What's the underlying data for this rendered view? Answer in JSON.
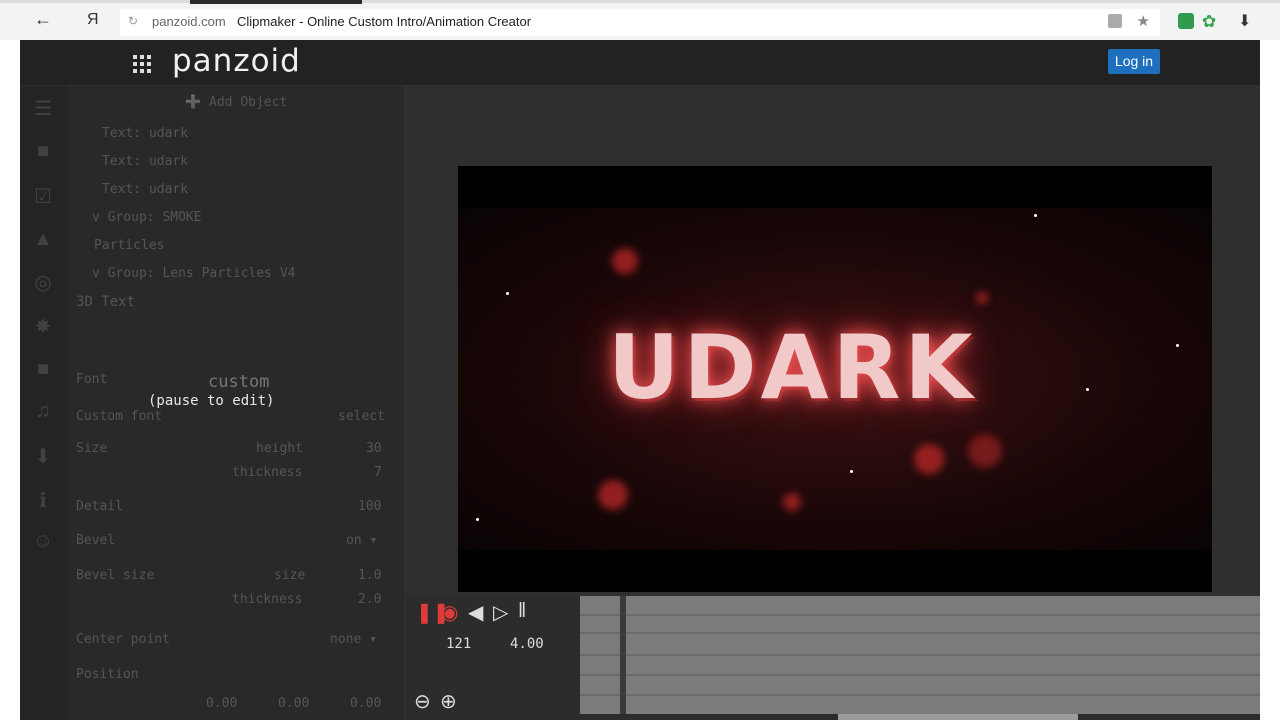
{
  "browser": {
    "back_icon": "back-arrow-icon",
    "yandex_label": "Я",
    "domain": "panzoid.com",
    "title": "Clipmaker - Online Custom Intro/Animation Creator"
  },
  "app": {
    "logo": "panzoid",
    "login_label": "Log in"
  },
  "panel": {
    "add_object": "➕ Add Object",
    "tree": [
      "Text: udark",
      "Text: udark",
      "Text: udark",
      "v Group: SMOKE",
      "Particles",
      "v Group: Lens Particles V4"
    ],
    "section": "3D Text",
    "font_label": "Font",
    "font_value": "custom",
    "custom_font_label": "Custom font",
    "custom_font_action": "select",
    "size_label": "Size",
    "height_label": "height",
    "height_value": "30",
    "thickness_label": "thickness",
    "thickness_value": "7",
    "detail_label": "Detail",
    "detail_value": "100",
    "bevel_label": "Bevel",
    "bevel_value": "on ▾",
    "bevel_size_label": "Bevel size",
    "bevel_size_size_label": "size",
    "bevel_size_size_value": "1.0",
    "bevel_thickness_label": "thickness",
    "bevel_thickness_value": "2.0",
    "center_label": "Center point",
    "center_value": "none ▾",
    "position_label": "Position",
    "position_values": [
      "0.00",
      "0.00",
      "0.00"
    ],
    "pause_note": "(pause to edit)"
  },
  "stage": {
    "text": "UDARK"
  },
  "timeline": {
    "frame": "121",
    "time": "4.00"
  },
  "colors": {
    "accent": "#1f6fbf",
    "app_bg": "#2f2f2f",
    "topbar_bg": "#222222"
  }
}
